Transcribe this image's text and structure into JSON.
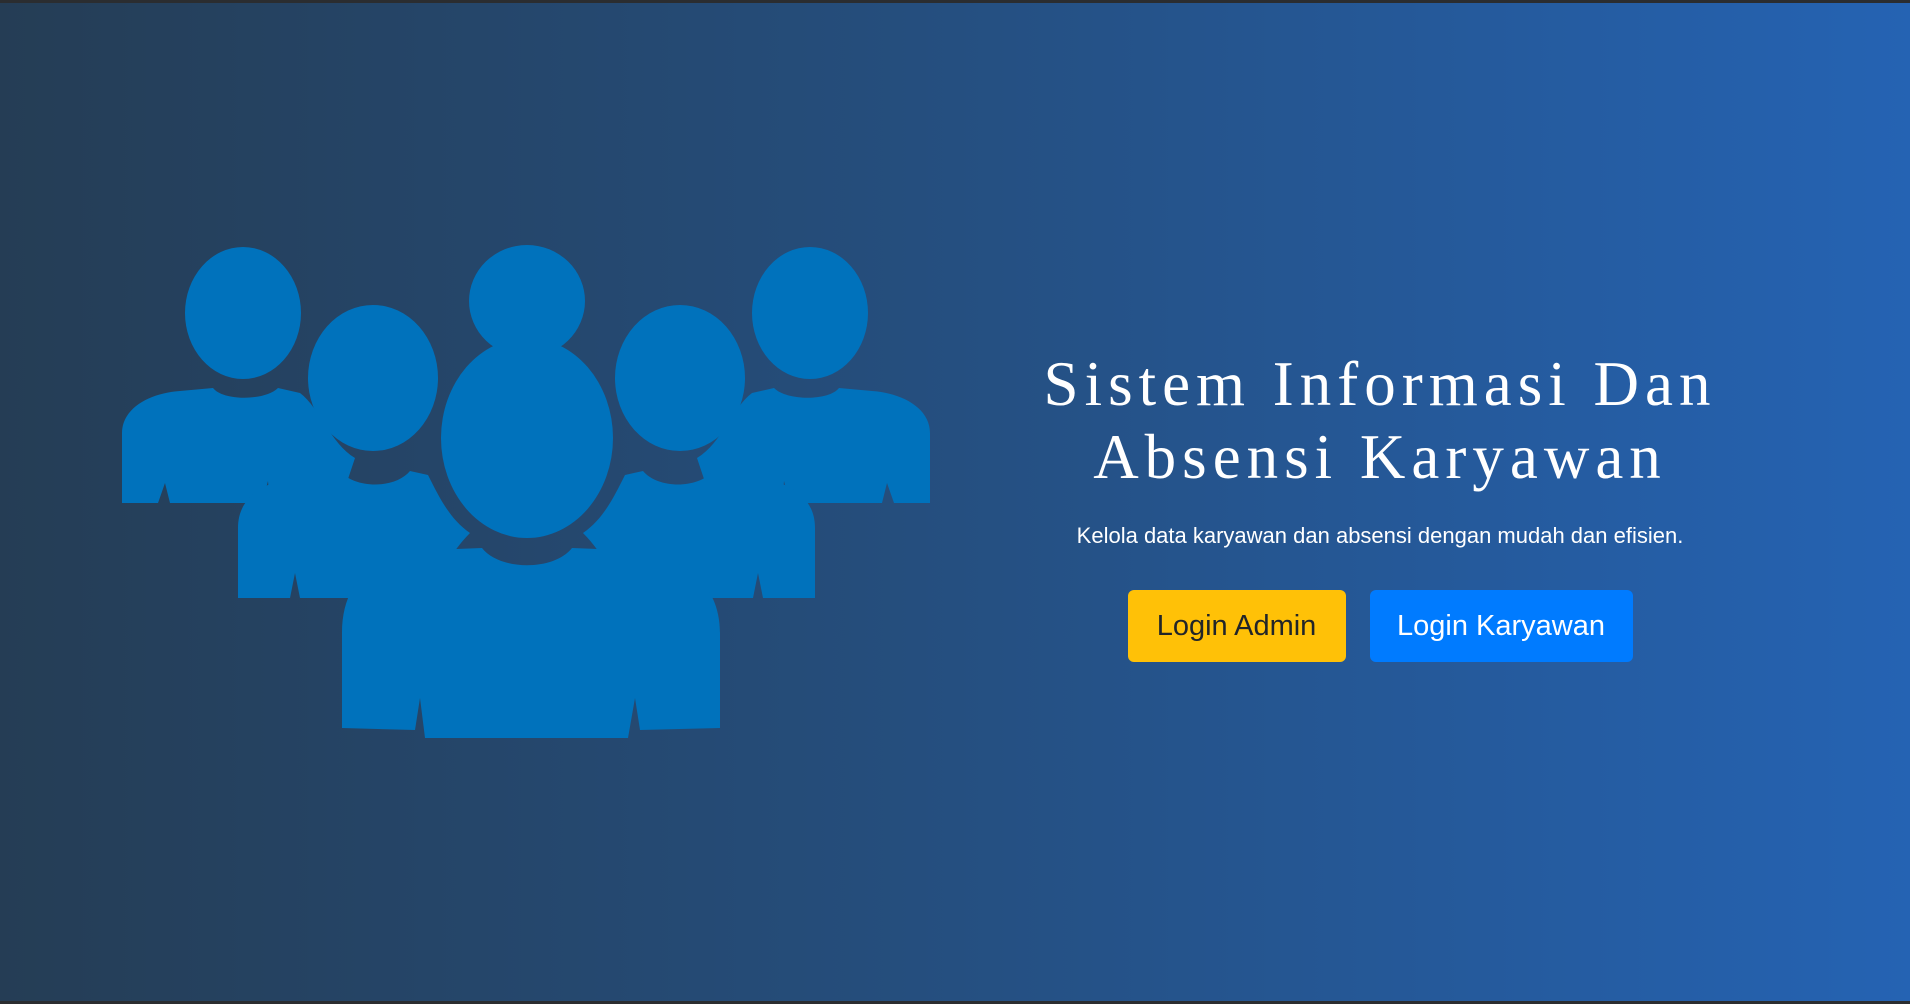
{
  "hero": {
    "illustration_icon": "users-group-icon",
    "title_line1": "Sistem Informasi Dan",
    "title_line2": "Absensi Karyawan",
    "subtitle": "Kelola data karyawan dan absensi dengan mudah dan efisien."
  },
  "buttons": {
    "admin_label": "Login Admin",
    "karyawan_label": "Login Karyawan"
  },
  "colors": {
    "gradient_start": "#253d55",
    "gradient_end": "#2563b3",
    "icon_fill": "#0072bc",
    "admin_button": "#ffc107",
    "karyawan_button": "#007bff"
  }
}
